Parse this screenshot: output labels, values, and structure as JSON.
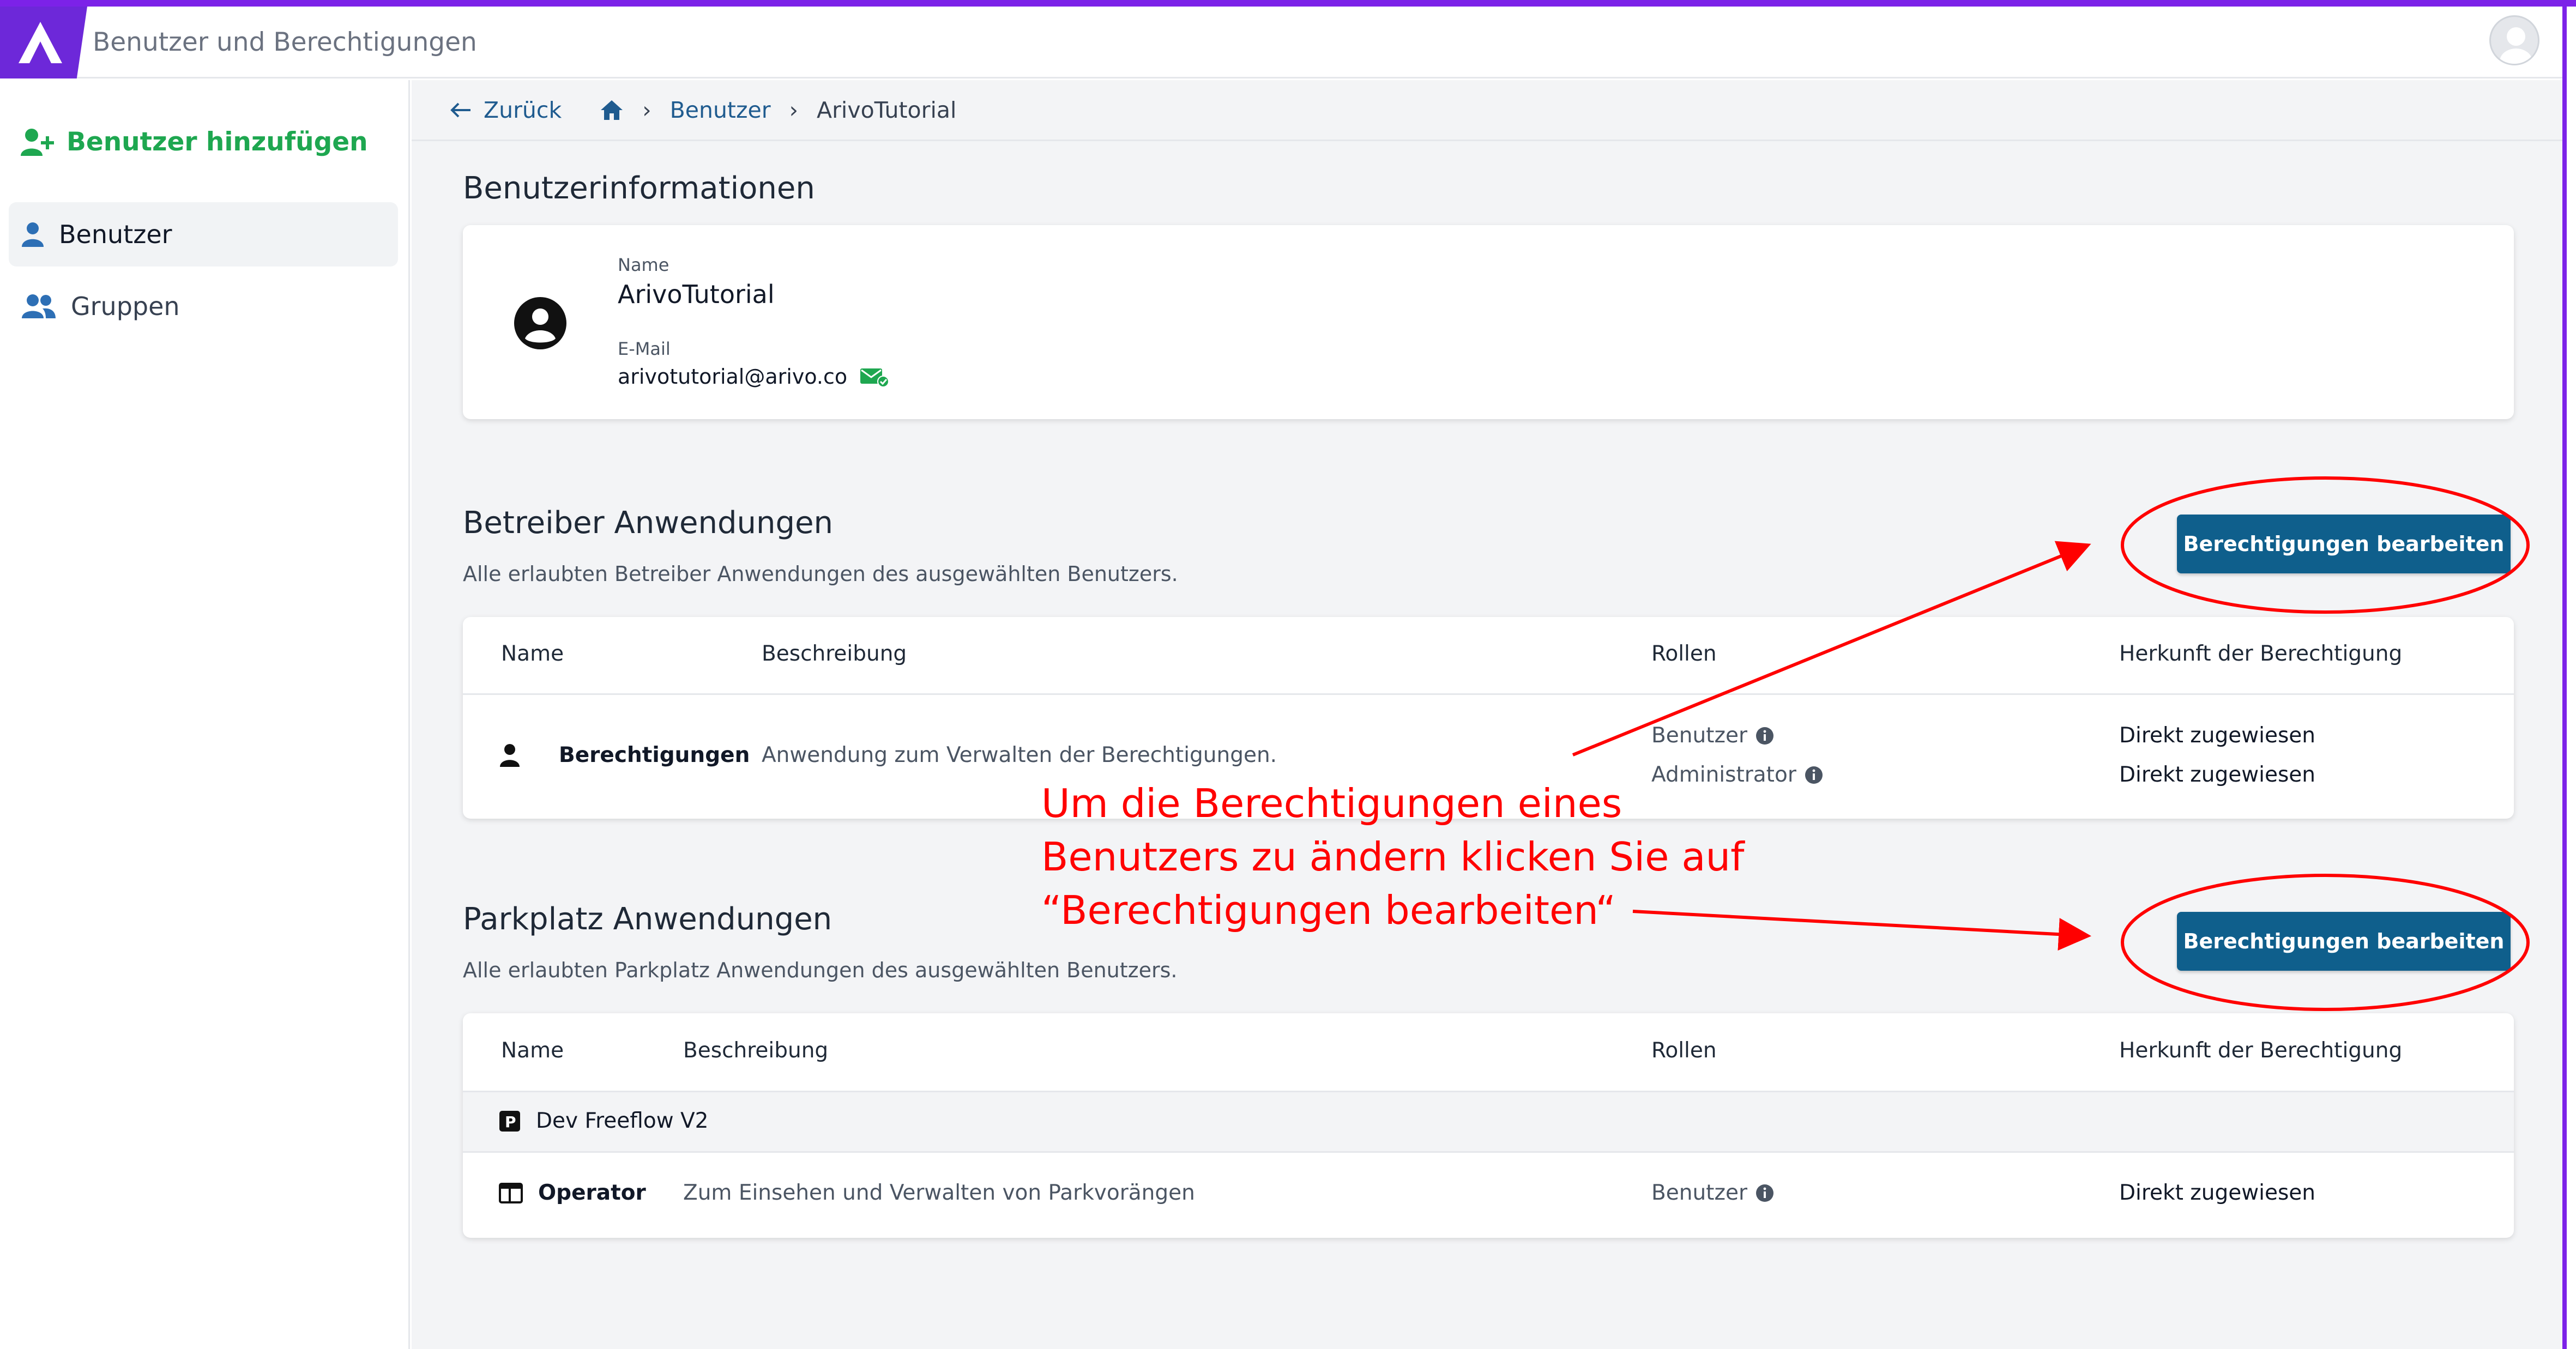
{
  "header": {
    "title": "Benutzer und Berechtigungen"
  },
  "sidebar": {
    "add_user": "Benutzer hinzufügen",
    "items": [
      {
        "label": "Benutzer",
        "icon": "user-icon"
      },
      {
        "label": "Gruppen",
        "icon": "group-icon"
      }
    ]
  },
  "breadcrumb": {
    "back": "Zurück",
    "users": "Benutzer",
    "current": "ArivoTutorial"
  },
  "user_info": {
    "title": "Benutzerinformationen",
    "name_label": "Name",
    "name": "ArivoTutorial",
    "email_label": "E-Mail",
    "email": "arivotutorial@arivo.co"
  },
  "operator_apps": {
    "title": "Betreiber Anwendungen",
    "subtitle": "Alle erlaubten Betreiber Anwendungen des ausgewählten Benutzers.",
    "button": "Berechtigungen bearbeiten",
    "headers": [
      "Name",
      "Beschreibung",
      "Rollen",
      "Herkunft der Berechtigung"
    ],
    "rows": [
      {
        "name": "Berechtigungen",
        "description": "Anwendung zum Verwalten der Berechtigungen.",
        "roles": [
          "Benutzer",
          "Administrator"
        ],
        "origins": [
          "Direkt zugewiesen",
          "Direkt zugewiesen"
        ]
      }
    ]
  },
  "parking_apps": {
    "title": "Parkplatz Anwendungen",
    "subtitle": "Alle erlaubten Parkplatz Anwendungen des ausgewählten Benutzers.",
    "button": "Berechtigungen bearbeiten",
    "headers": [
      "Name",
      "Beschreibung",
      "Rollen",
      "Herkunft der Berechtigung"
    ],
    "group": "Dev Freeflow V2",
    "rows": [
      {
        "name": "Operator",
        "description": "Zum Einsehen und Verwalten von Parkvorängen",
        "roles": [
          "Benutzer"
        ],
        "origins": [
          "Direkt zugewiesen"
        ]
      }
    ]
  },
  "annotation": {
    "lines": [
      "Um die Berechtigungen eines",
      "Benutzers zu ändern klicken Sie auf",
      "“Berechtigungen bearbeiten“"
    ],
    "color": "#ff0000"
  },
  "colors": {
    "accent": "#7c22e8",
    "button": "#0f5f8c",
    "green": "#1ea750"
  }
}
